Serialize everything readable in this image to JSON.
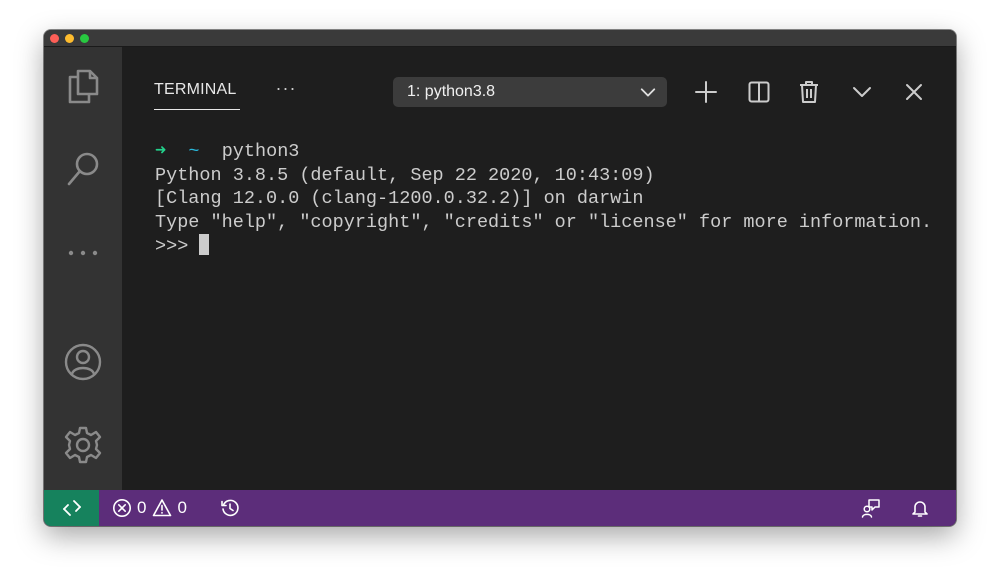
{
  "window": {
    "traffic_lights": [
      "close",
      "minimize",
      "zoom"
    ]
  },
  "activity_bar": {
    "items": [
      {
        "name": "explorer",
        "icon": "files-icon"
      },
      {
        "name": "search",
        "icon": "search-icon"
      },
      {
        "name": "more",
        "icon": "ellipsis-icon"
      },
      {
        "name": "accounts",
        "icon": "account-icon"
      },
      {
        "name": "manage",
        "icon": "gear-icon"
      }
    ]
  },
  "panel": {
    "tab_label": "TERMINAL",
    "more_label": "···",
    "terminal_select": "1: python3.8",
    "actions": [
      "add-icon",
      "split-icon",
      "trash-icon",
      "chevron-down-icon",
      "close-icon"
    ]
  },
  "terminal": {
    "prompt_arrow": "➜",
    "prompt_dir": "~",
    "command": "python3",
    "output": [
      "Python 3.8.5 (default, Sep 22 2020, 10:43:09)",
      "[Clang 12.0.0 (clang-1200.0.32.2)] on darwin",
      "Type \"help\", \"copyright\", \"credits\" or \"license\" for more information."
    ],
    "repl_prompt": ">>>"
  },
  "status_bar": {
    "errors": "0",
    "warnings": "0"
  },
  "colors": {
    "status_bar": "#5c2d7a",
    "remote_indicator": "#16825d",
    "prompt_arrow": "#23d18b",
    "prompt_dir": "#29b8db"
  }
}
